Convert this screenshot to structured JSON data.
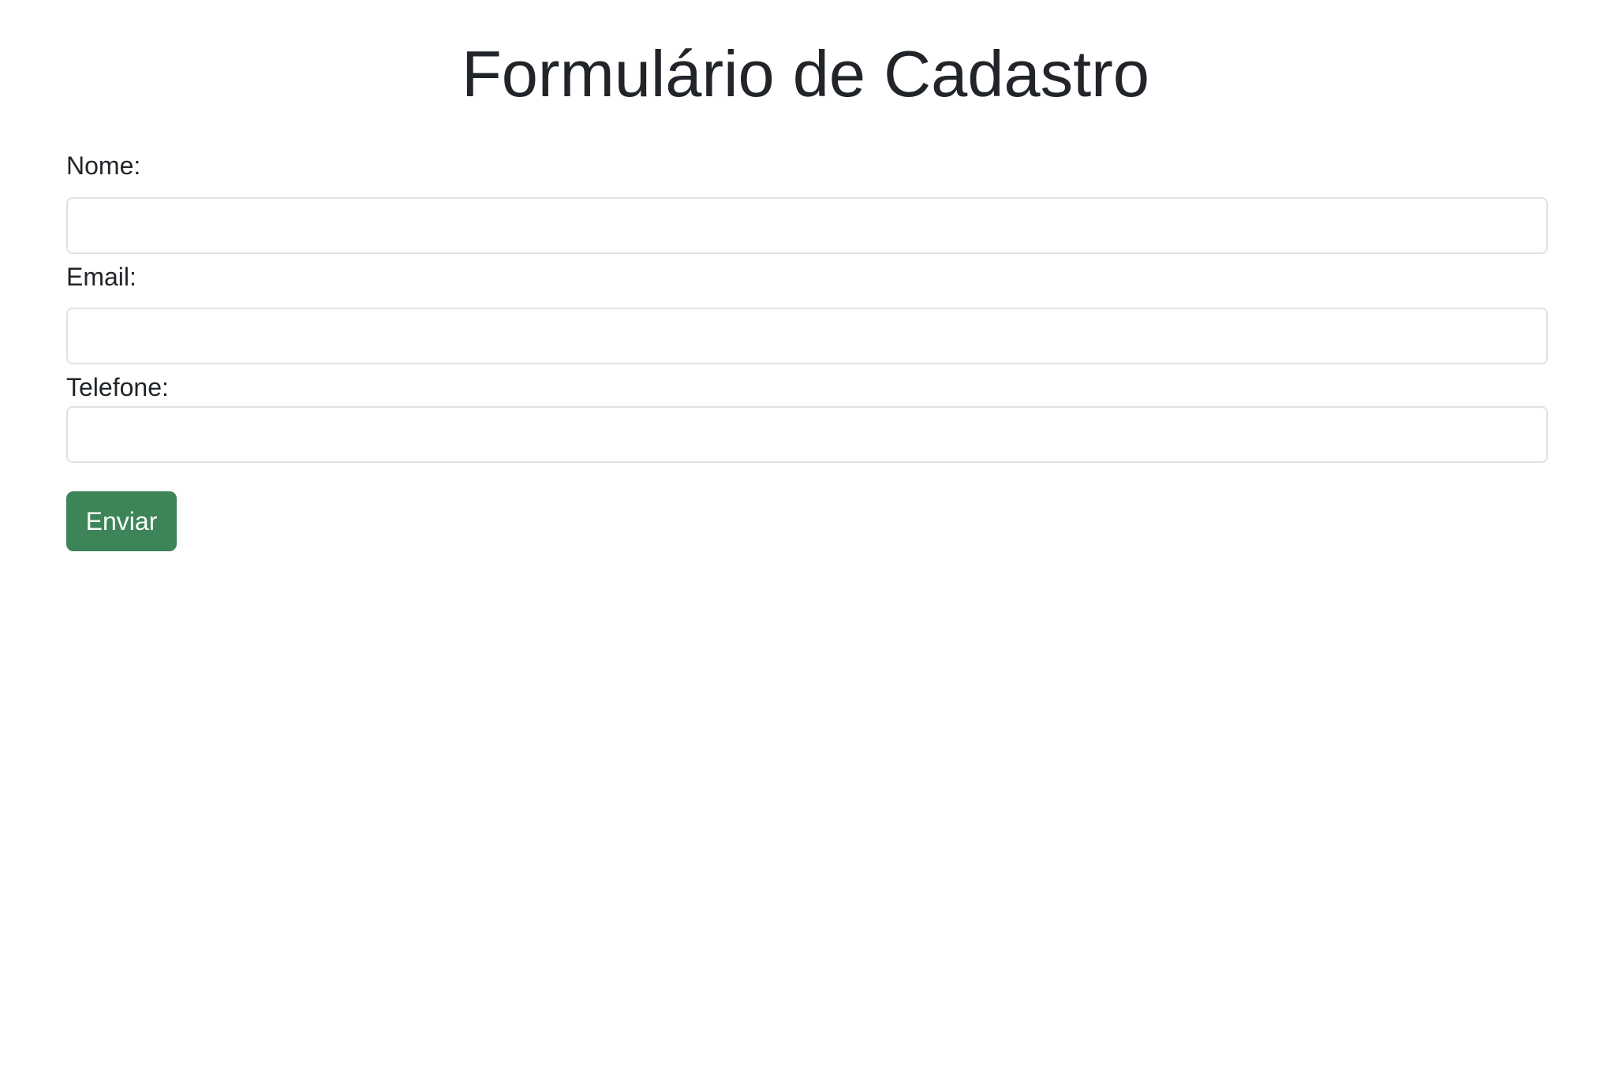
{
  "page": {
    "title": "Formulário de Cadastro"
  },
  "form": {
    "fields": [
      {
        "label": "Nome:",
        "value": "",
        "placeholder": ""
      },
      {
        "label": "Email:",
        "value": "",
        "placeholder": ""
      },
      {
        "label": "Telefone:",
        "value": "",
        "placeholder": ""
      }
    ],
    "submit_label": "Enviar"
  },
  "colors": {
    "button_background": "#3d8558",
    "text": "#212529",
    "input_border": "#dee2e6"
  }
}
